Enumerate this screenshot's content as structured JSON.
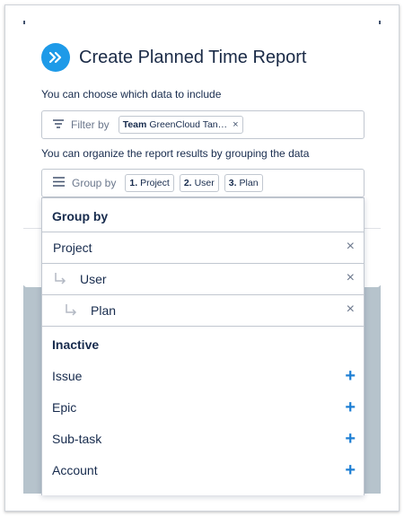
{
  "dialog": {
    "title": "Create Planned Time Report",
    "filter_hint": "You can choose which data to include",
    "group_hint": "You can organize the report results by grouping the data"
  },
  "filter": {
    "label": "Filter by",
    "chip_key": "Team",
    "chip_value": "GreenCloud Tan…",
    "chip_remove": "×"
  },
  "group": {
    "label": "Group by",
    "chips": [
      {
        "num": "1.",
        "text": "Project"
      },
      {
        "num": "2.",
        "text": "User"
      },
      {
        "num": "3.",
        "text": "Plan"
      }
    ]
  },
  "dropdown": {
    "active_heading": "Group by",
    "active": [
      {
        "label": "Project",
        "remove": "×"
      },
      {
        "label": "User",
        "remove": "×"
      },
      {
        "label": "Plan",
        "remove": "×"
      }
    ],
    "inactive_heading": "Inactive",
    "inactive": [
      {
        "label": "Issue",
        "add": "+"
      },
      {
        "label": "Epic",
        "add": "+"
      },
      {
        "label": "Sub-task",
        "add": "+"
      },
      {
        "label": "Account",
        "add": "+"
      }
    ]
  },
  "icons": {
    "title": "double-chevron-right-icon",
    "filter": "filter-icon",
    "group": "menu-icon",
    "nested": "nested-arrow-icon"
  },
  "colors": {
    "accent": "#1e9ae8",
    "add": "#1e7fd4",
    "backdrop": "#b6c3cc"
  }
}
